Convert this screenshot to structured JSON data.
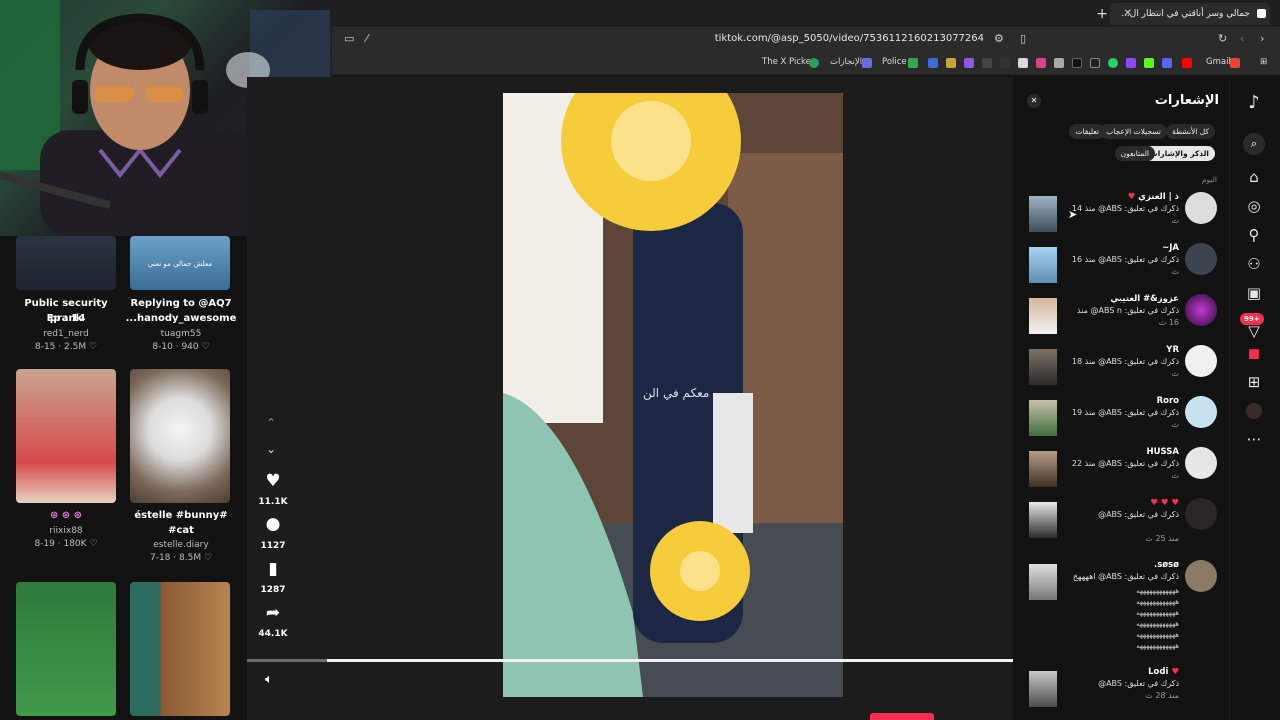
{
  "browser": {
    "tab_title": "جمالي وسر أناقتي في انتظار ال...",
    "url": "tiktok.com/@asp_5050/video/7536112160213077264",
    "bookmarks": [
      "Gmail",
      "Police",
      "الإنجازات",
      "The X Picker"
    ]
  },
  "feed": {
    "cards": [
      {
        "title_line1": "Public security prank",
        "title_line2": "Ep : 14",
        "user": "red1_nerd",
        "date": "8-15",
        "likes": "2.5M"
      },
      {
        "title_line1": "Replying to @AQ7",
        "title_line2": "...hanody_awesome",
        "user": "tuagm55",
        "date": "8-10",
        "likes": "940",
        "overlay_text": "معلش جمالي مو تعني"
      },
      {
        "title_line1": "",
        "title_line2": "",
        "user": "riixix88",
        "date": "8-19",
        "likes": "180K"
      },
      {
        "title_line1": "éstelle #bunny#",
        "title_line2": "#cat",
        "user": "estelle.diary",
        "date": "7-18",
        "likes": "8.5M"
      }
    ]
  },
  "player": {
    "overlay_text": "معكم في الن",
    "actions": {
      "likes": "11.1K",
      "comments": "1127",
      "saves": "1287",
      "shares": "44.1K"
    }
  },
  "notifications": {
    "title": "الإشعارات",
    "filters": [
      {
        "label": "كل الأنشطة",
        "active": false
      },
      {
        "label": "تسجيلات الإعجاب",
        "active": false
      },
      {
        "label": "تعليقات",
        "active": false
      },
      {
        "label": "الذكر والإشارات",
        "active": true
      },
      {
        "label": "المتابعون",
        "active": false
      }
    ],
    "section_today": "اليوم",
    "items": [
      {
        "name": "ذ | العنزي",
        "text": "ذكرك في تعليق: ABS@ منذ 14",
        "time": "ث"
      },
      {
        "name": "JA~",
        "text": "ذكرك في تعليق: ABS@ منذ 16",
        "time": "ث"
      },
      {
        "name": "عزوز&# العتيبي",
        "text": "ذكرك في تعليق: ABS n@ منذ",
        "time": "16 ث"
      },
      {
        "name": "YR",
        "text": "ذكرك في تعليق: ABS@ منذ 18",
        "time": "ث"
      },
      {
        "name": "Roro",
        "text": "ذكرك في تعليق: ABS@ منذ 19",
        "time": "ث"
      },
      {
        "name": "HUSSA",
        "text": "ذكرك في تعليق: ABS@ منذ 22",
        "time": "ث"
      },
      {
        "name": "",
        "text": "ذكرك في تعليق: ABS@",
        "time": "منذ 25 ث"
      },
      {
        "name": "søsø.",
        "text": "ذكرك في تعليق: ABS@ اههههخ",
        "time": ""
      },
      {
        "name": "Lodi",
        "text": "ذكرك في تعليق: ABS@",
        "time": "منذ 28 ث"
      }
    ]
  },
  "rail": {
    "badge": "99+"
  }
}
